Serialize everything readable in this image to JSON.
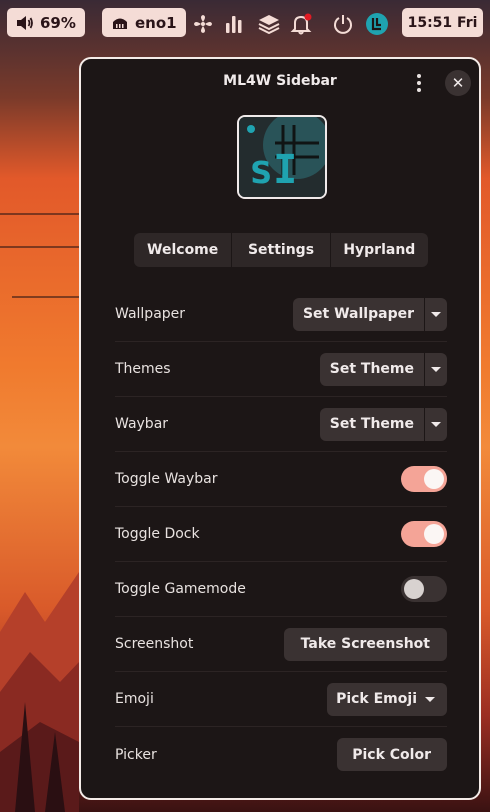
{
  "topbar": {
    "volume": {
      "value": "69%"
    },
    "network": {
      "label": "eno1"
    },
    "clock": {
      "label": "15:51 Fri"
    },
    "tray_icons": [
      "fan-icon",
      "equalizer-icon",
      "layers-icon",
      "notification-bell-icon",
      "power-icon",
      "ml4w-avatar-icon"
    ]
  },
  "sidebar": {
    "title": "ML4W Sidebar",
    "tabs": [
      {
        "label": "Welcome"
      },
      {
        "label": "Settings"
      },
      {
        "label": "Hyprland"
      }
    ],
    "rows": {
      "wallpaper": {
        "label": "Wallpaper",
        "action": "Set Wallpaper"
      },
      "themes": {
        "label": "Themes",
        "action": "Set Theme"
      },
      "waybar": {
        "label": "Waybar",
        "action": "Set Theme"
      },
      "toggle_waybar": {
        "label": "Toggle Waybar",
        "state": true
      },
      "toggle_dock": {
        "label": "Toggle Dock",
        "state": true
      },
      "toggle_gamemode": {
        "label": "Toggle Gamemode",
        "state": false
      },
      "screenshot": {
        "label": "Screenshot",
        "action": "Take Screenshot"
      },
      "emoji": {
        "label": "Emoji",
        "action": "Pick Emoji"
      },
      "picker": {
        "label": "Picker",
        "action": "Pick Color"
      }
    }
  },
  "colors": {
    "accent": "#f4a497",
    "window_bg": "#1c1616",
    "button_bg": "#3a3232",
    "logo_teal": "#1fa3b0",
    "notification_dot": "#e01b24"
  }
}
